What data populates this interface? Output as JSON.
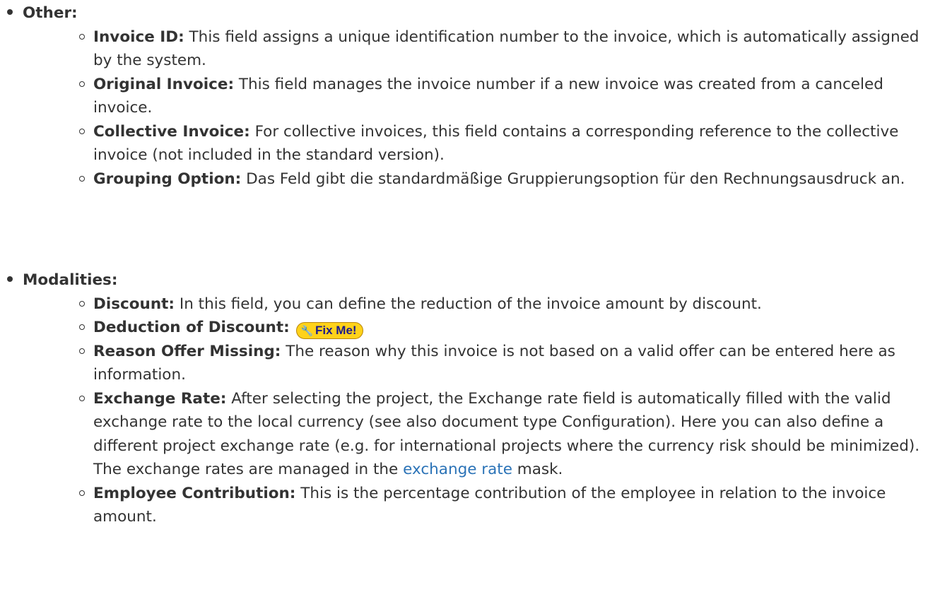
{
  "sections": [
    {
      "label": "Other:",
      "items": [
        {
          "term": "Invoice ID:",
          "text": " This field assigns a unique identification number to the invoice, which is automatically assigned by the system."
        },
        {
          "term": "Original Invoice:",
          "text": " This field manages the invoice number if a new invoice was created from a canceled invoice."
        },
        {
          "term": "Collective Invoice:",
          "text": " For collective invoices, this field contains a corresponding reference to the collective invoice (not included in the standard version)."
        },
        {
          "term": "Grouping Option:",
          "text": " Das Feld gibt die standardmäßige Gruppierungsoption für den Rechnungsausdruck an."
        }
      ]
    },
    {
      "label": "Modalities:",
      "items": [
        {
          "term": "Discount:",
          "text": " In this field, you can define the reduction of the invoice amount by discount."
        },
        {
          "term": "Deduction of Discount:",
          "badge": "Fix Me!",
          "badge_icon": "wrench-icon"
        },
        {
          "term": "Reason Offer Missing:",
          "text": " The reason why this invoice is not based on a valid offer can be entered here as information."
        },
        {
          "term": "Exchange Rate:",
          "text": " After selecting the project, the Exchange rate field is automatically filled with the valid exchange rate to the local currency (see also document type Configuration). Here you can also define a different project exchange rate (e.g. for international projects where the currency risk should be minimized). The exchange rates are managed in the ",
          "link": "exchange rate",
          "text_after": " mask."
        },
        {
          "term": "Employee Contribution:",
          "text": " This is the percentage contribution of the employee in relation to the invoice amount."
        }
      ]
    }
  ]
}
